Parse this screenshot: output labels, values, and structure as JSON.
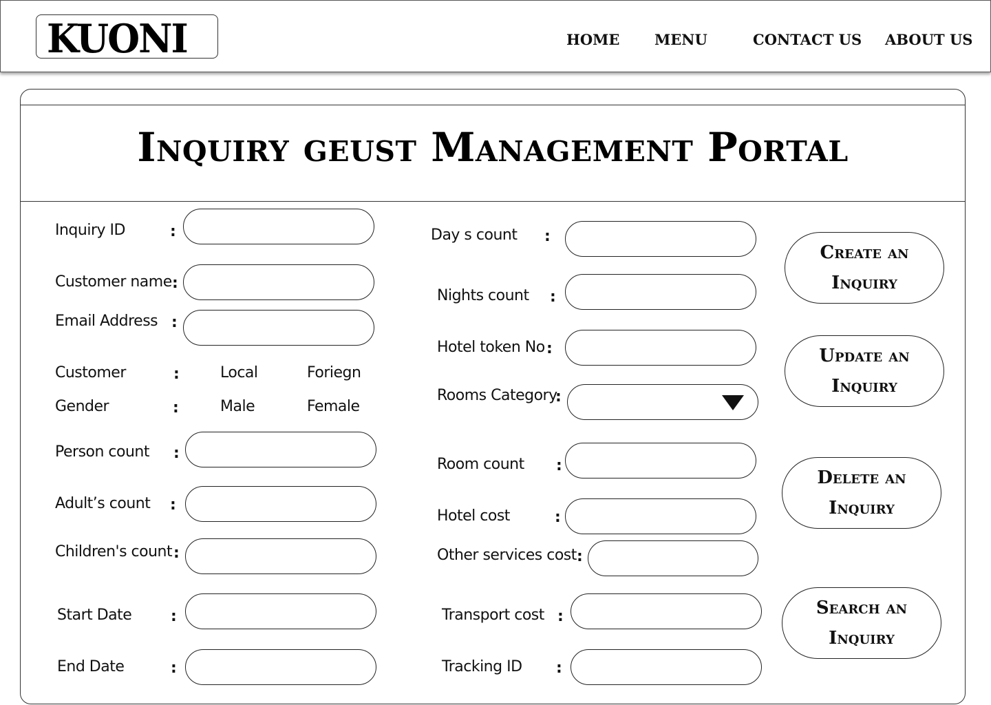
{
  "header": {
    "logo": "KUONI",
    "nav": [
      "HOME",
      "MENU",
      "CONTACT US",
      "ABOUT US"
    ]
  },
  "page_title": "Inquiry geust Management Portal",
  "left_form": {
    "inquiry_id": "Inquiry ID",
    "customer_name": "Customer name",
    "email": "Email Address",
    "customer": "Customer",
    "customer_local": "Local",
    "customer_foreign": "Foriegn",
    "gender": "Gender",
    "gender_male": "Male",
    "gender_female": "Female",
    "person_count": "Person count",
    "adults_count": "Adult’s count",
    "children_count": "Children's count",
    "start_date": "Start Date",
    "end_date": "End Date"
  },
  "right_form": {
    "days_count": "Day s count",
    "nights_count": "Nights count",
    "hotel_token": "Hotel token No",
    "rooms_category": "Rooms Category",
    "room_count": "Room count",
    "hotel_cost": "Hotel cost",
    "other_services_cost": "Other services  cost",
    "transport_cost": "Transport cost",
    "tracking_id": "Tracking ID"
  },
  "colon": ":",
  "actions": {
    "create": "Create an Inquiry",
    "update": "Update an Inquiry",
    "delete": "Delete  an Inquiry",
    "search": "Search an Inquiry"
  }
}
